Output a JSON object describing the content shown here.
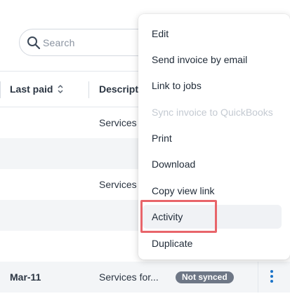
{
  "search": {
    "placeholder": "Search"
  },
  "table": {
    "columns": [
      {
        "label": "Last paid",
        "sortable": true
      },
      {
        "label": "Descripti"
      }
    ],
    "rows": [
      {
        "last_paid": "",
        "description": "Services f"
      },
      {
        "last_paid": "",
        "description": ""
      },
      {
        "last_paid": "",
        "description": "Services f"
      },
      {
        "last_paid": "",
        "description": ""
      },
      {
        "last_paid": "",
        "description": ""
      },
      {
        "last_paid": "Mar-11",
        "description": "Services for...",
        "status": "Not synced"
      }
    ]
  },
  "menu": {
    "items": [
      {
        "label": "Edit"
      },
      {
        "label": "Send invoice by email"
      },
      {
        "label": "Link to jobs"
      },
      {
        "label": "Sync invoice to QuickBooks",
        "disabled": true
      },
      {
        "label": "Print"
      },
      {
        "label": "Download"
      },
      {
        "label": "Copy view link"
      },
      {
        "label": "Activity",
        "highlighted": true
      },
      {
        "label": "Duplicate"
      }
    ]
  },
  "colors": {
    "accent": "#1a73c8",
    "badge": "#6e7786",
    "highlight": "#e8656a",
    "disabled_text": "#c4cad2"
  }
}
